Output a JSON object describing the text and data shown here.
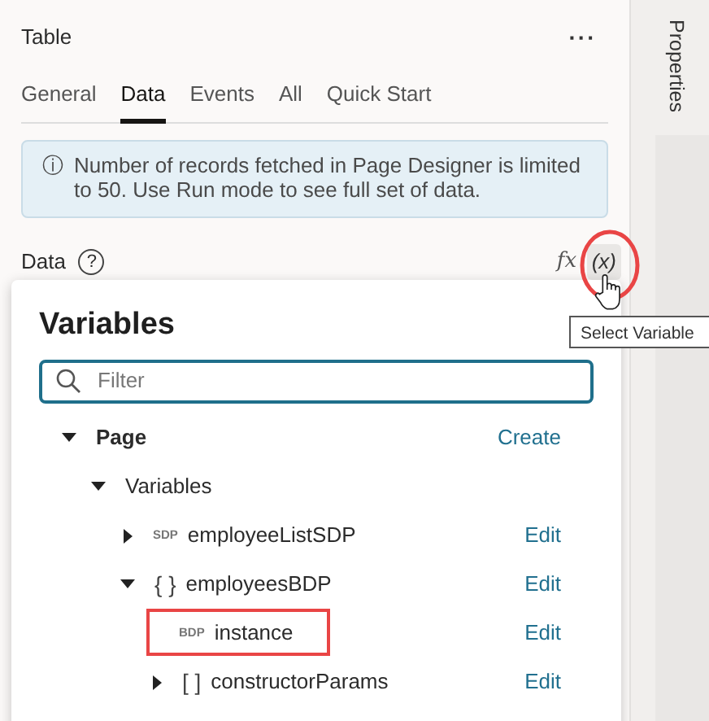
{
  "panel": {
    "title": "Table",
    "menu": "···"
  },
  "tabs": [
    {
      "label": "General",
      "selected": false
    },
    {
      "label": "Data",
      "selected": true
    },
    {
      "label": "Events",
      "selected": false
    },
    {
      "label": "All",
      "selected": false
    },
    {
      "label": "Quick Start",
      "selected": false
    }
  ],
  "notice": {
    "icon": "ⓘ",
    "text": "Number of records fetched in Page Designer is limited to 50. Use Run mode to see full set of data."
  },
  "data_field": {
    "label": "Data",
    "help": "?",
    "fx": "fx",
    "variable_button": "(x)"
  },
  "tooltip": "Select Variable",
  "sidebar": {
    "label": "Properties"
  },
  "variables_popup": {
    "title": "Variables",
    "filter_placeholder": "Filter",
    "tree": [
      {
        "label": "Page",
        "expanded": true,
        "action": "Create",
        "children": [
          {
            "label": "Variables",
            "expanded": true,
            "children": [
              {
                "label": "employeeListSDP",
                "type_badge": "SDP",
                "expanded": false,
                "action": "Edit"
              },
              {
                "label": "employeesBDP",
                "type_badge": "{ }",
                "expanded": true,
                "action": "Edit",
                "children": [
                  {
                    "label": "instance",
                    "type_badge": "BDP",
                    "action": "Edit",
                    "highlighted": true
                  },
                  {
                    "label": "constructorParams",
                    "type_badge": "[ ]",
                    "expanded": false,
                    "action": "Edit"
                  }
                ]
              }
            ]
          }
        ]
      }
    ]
  }
}
